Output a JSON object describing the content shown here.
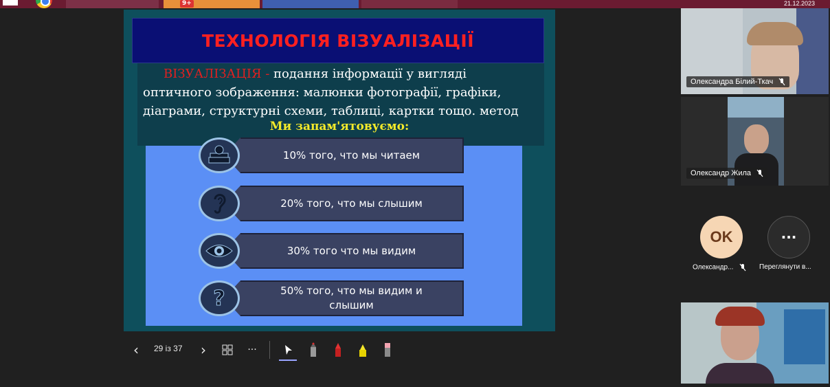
{
  "system": {
    "date": "21.12.2023",
    "badge": "9+"
  },
  "slide": {
    "title": "ТЕХНОЛОГІЯ ВІЗУАЛІЗАЦІЇ",
    "term": "ВІЗУАЛІЗАЦІЯ",
    "dash": " - ",
    "definition": "подання інформації у вигляді оптичного зображення: малюнки  фотографії, графіки, діаграми, структурні схеми, таблиці, картки  тощо. метод",
    "subtitle": "Ми запам'ятовуємо:",
    "items": [
      {
        "text": "10% того, что мы читаем",
        "icon": "book-apple-icon"
      },
      {
        "text": "20% того, что мы слышим",
        "icon": "ear-icon"
      },
      {
        "text": "30% того что мы видим",
        "icon": "eye-icon"
      },
      {
        "text": "50% того, что мы видим и слышим",
        "icon": "question-mark-icon"
      }
    ]
  },
  "presenter_toolbar": {
    "prev": "‹",
    "next": "›",
    "page_counter": "29 із 37",
    "more": "···"
  },
  "participants": [
    {
      "name": "Олександра Білий-Ткач",
      "muted": true
    },
    {
      "name": "Олександр Жила",
      "muted": true
    },
    {
      "initials": "OK",
      "name": "Олександр...",
      "muted": true
    },
    {
      "more": "···",
      "name": "Переглянути в..."
    }
  ],
  "colors": {
    "slide_bg": "#0e4f5c",
    "title_bar": "#0a0f74",
    "title_text": "#ff2020",
    "subtitle_text": "#f4ea2a",
    "panel": "#5b8ff5",
    "taskbar": "#6b1b31"
  }
}
